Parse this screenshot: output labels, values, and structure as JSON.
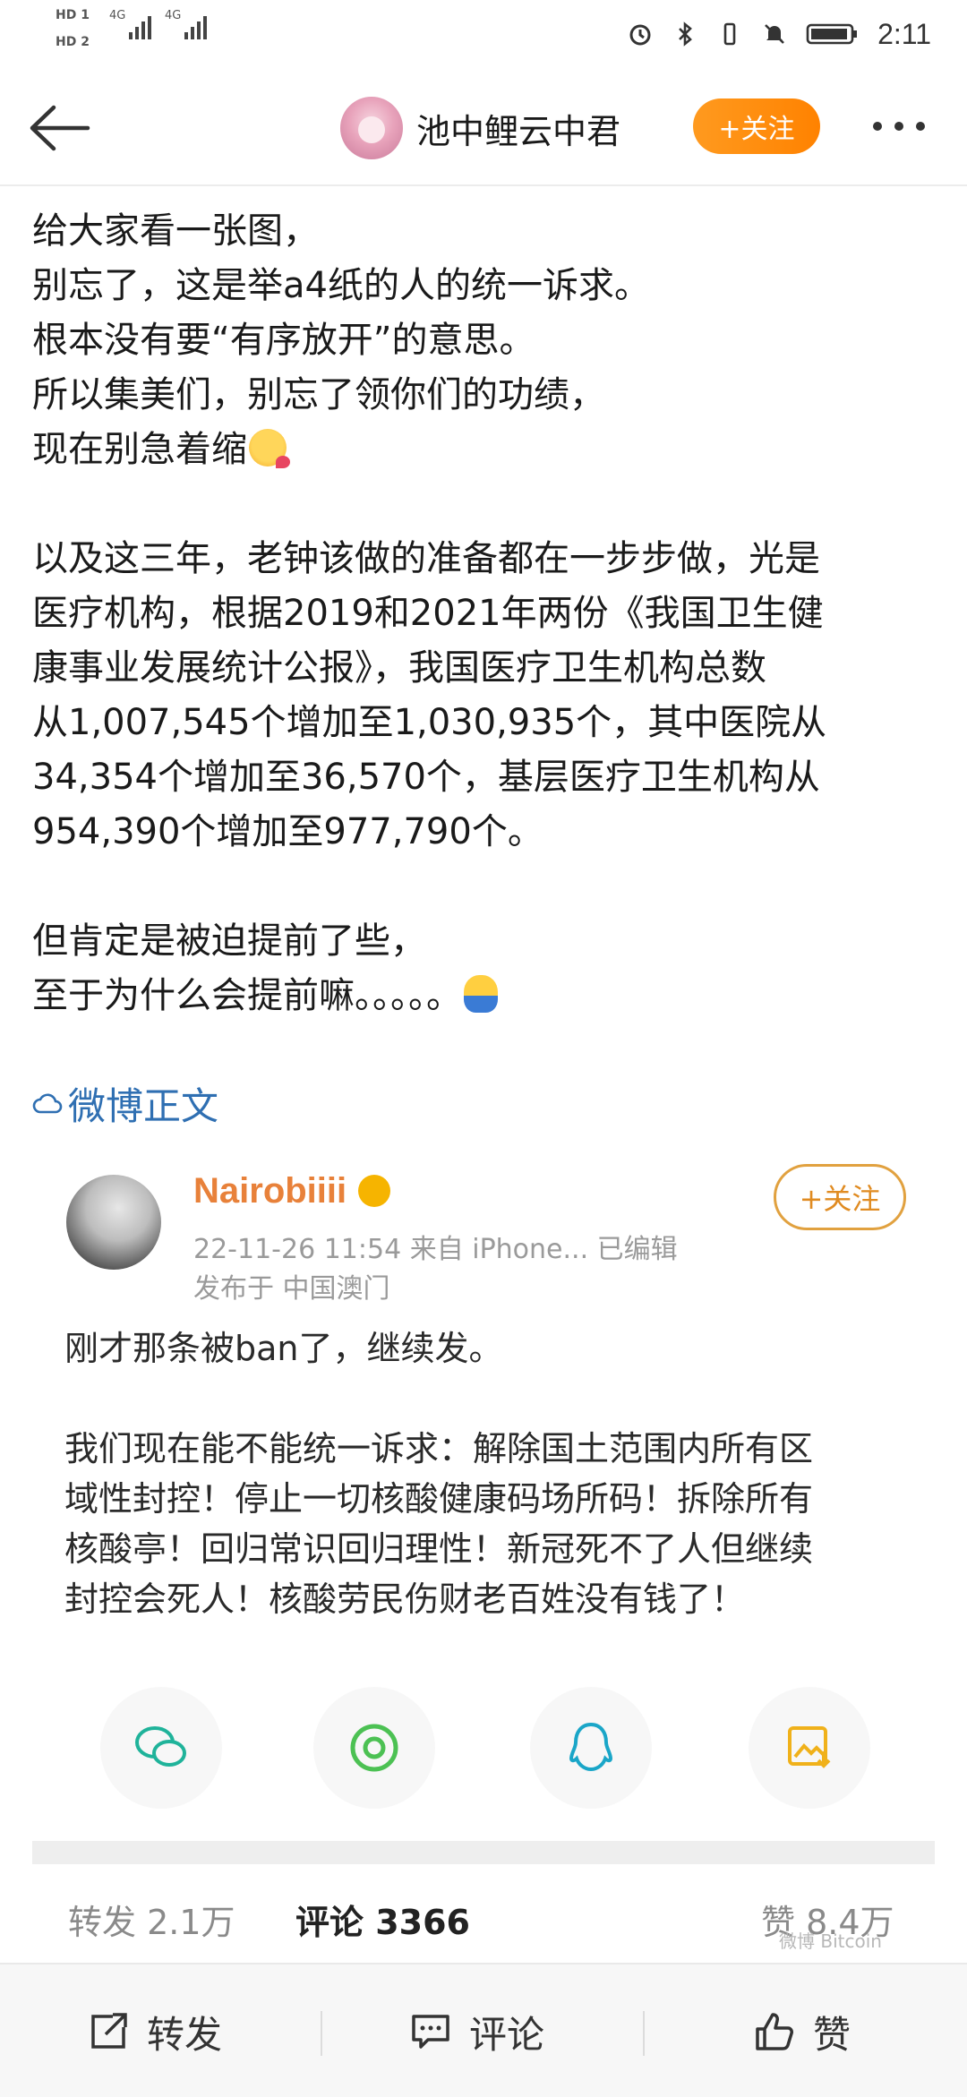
{
  "status_bar": {
    "sim1": "HD 1",
    "sim2": "HD 2",
    "net1": "4G",
    "net2": "4G",
    "time": "2:11",
    "icons": [
      "alarm-icon",
      "bluetooth-icon",
      "vibrate-icon",
      "mute-icon",
      "battery-icon"
    ]
  },
  "header": {
    "username": "池中鲤云中君",
    "follow_label": "+关注"
  },
  "post": {
    "lines_a": [
      "给大家看一张图，",
      "别忘了，这是举a4纸的人的统一诉求。",
      "根本没有要“有序放开”的意思。",
      "所以集美们，别忘了领你们的功绩，",
      "现在别急着缩"
    ],
    "lines_b": [
      "以及这三年，老钟该做的准备都在一步步做，光是",
      "医疗机构，根据2019和2021年两份《我国卫生健",
      "康事业发展统计公报》，我国医疗卫生机构总数",
      "从1,007,545个增加至1,030,935个，其中医院从",
      "34,354个增加至36,570个，基层医疗卫生机构从",
      "954,390个增加至977,790个。"
    ],
    "lines_c": [
      "但肯定是被迫提前了些，",
      "至于为什么会提前嘛。。。。。"
    ],
    "source_link": "微博正文"
  },
  "card": {
    "name": "Nairobiiii",
    "meta": "22-11-26 11:54   来自 iPhone...   已编辑",
    "location": "发布于 中国澳门",
    "follow_label": "+关注",
    "body_1": "刚才那条被ban了，继续发。",
    "body_2": [
      "我们现在能不能统一诉求：解除国土范围内所有区",
      "域性封控！停止一切核酸健康码场所码！拆除所有",
      "核酸亭！回归常识回归理性！新冠死不了人但继续",
      "封控会死人！核酸劳民伤财老百姓没有钱了！"
    ],
    "share_icons": [
      "wechat-icon",
      "moments-icon",
      "qq-icon",
      "save-image-icon"
    ]
  },
  "stats": {
    "reposts": "转发 2.1万",
    "comments": "评论 3366",
    "likes": "赞 8.4万",
    "watermark": "微博 Bitcoin"
  },
  "bottom_bar": {
    "repost": "转发",
    "comment": "评论",
    "like": "赞"
  },
  "colors": {
    "accent_orange": "#ff8200",
    "link_blue": "#2f6fb2",
    "card_name": "#e8813a"
  }
}
